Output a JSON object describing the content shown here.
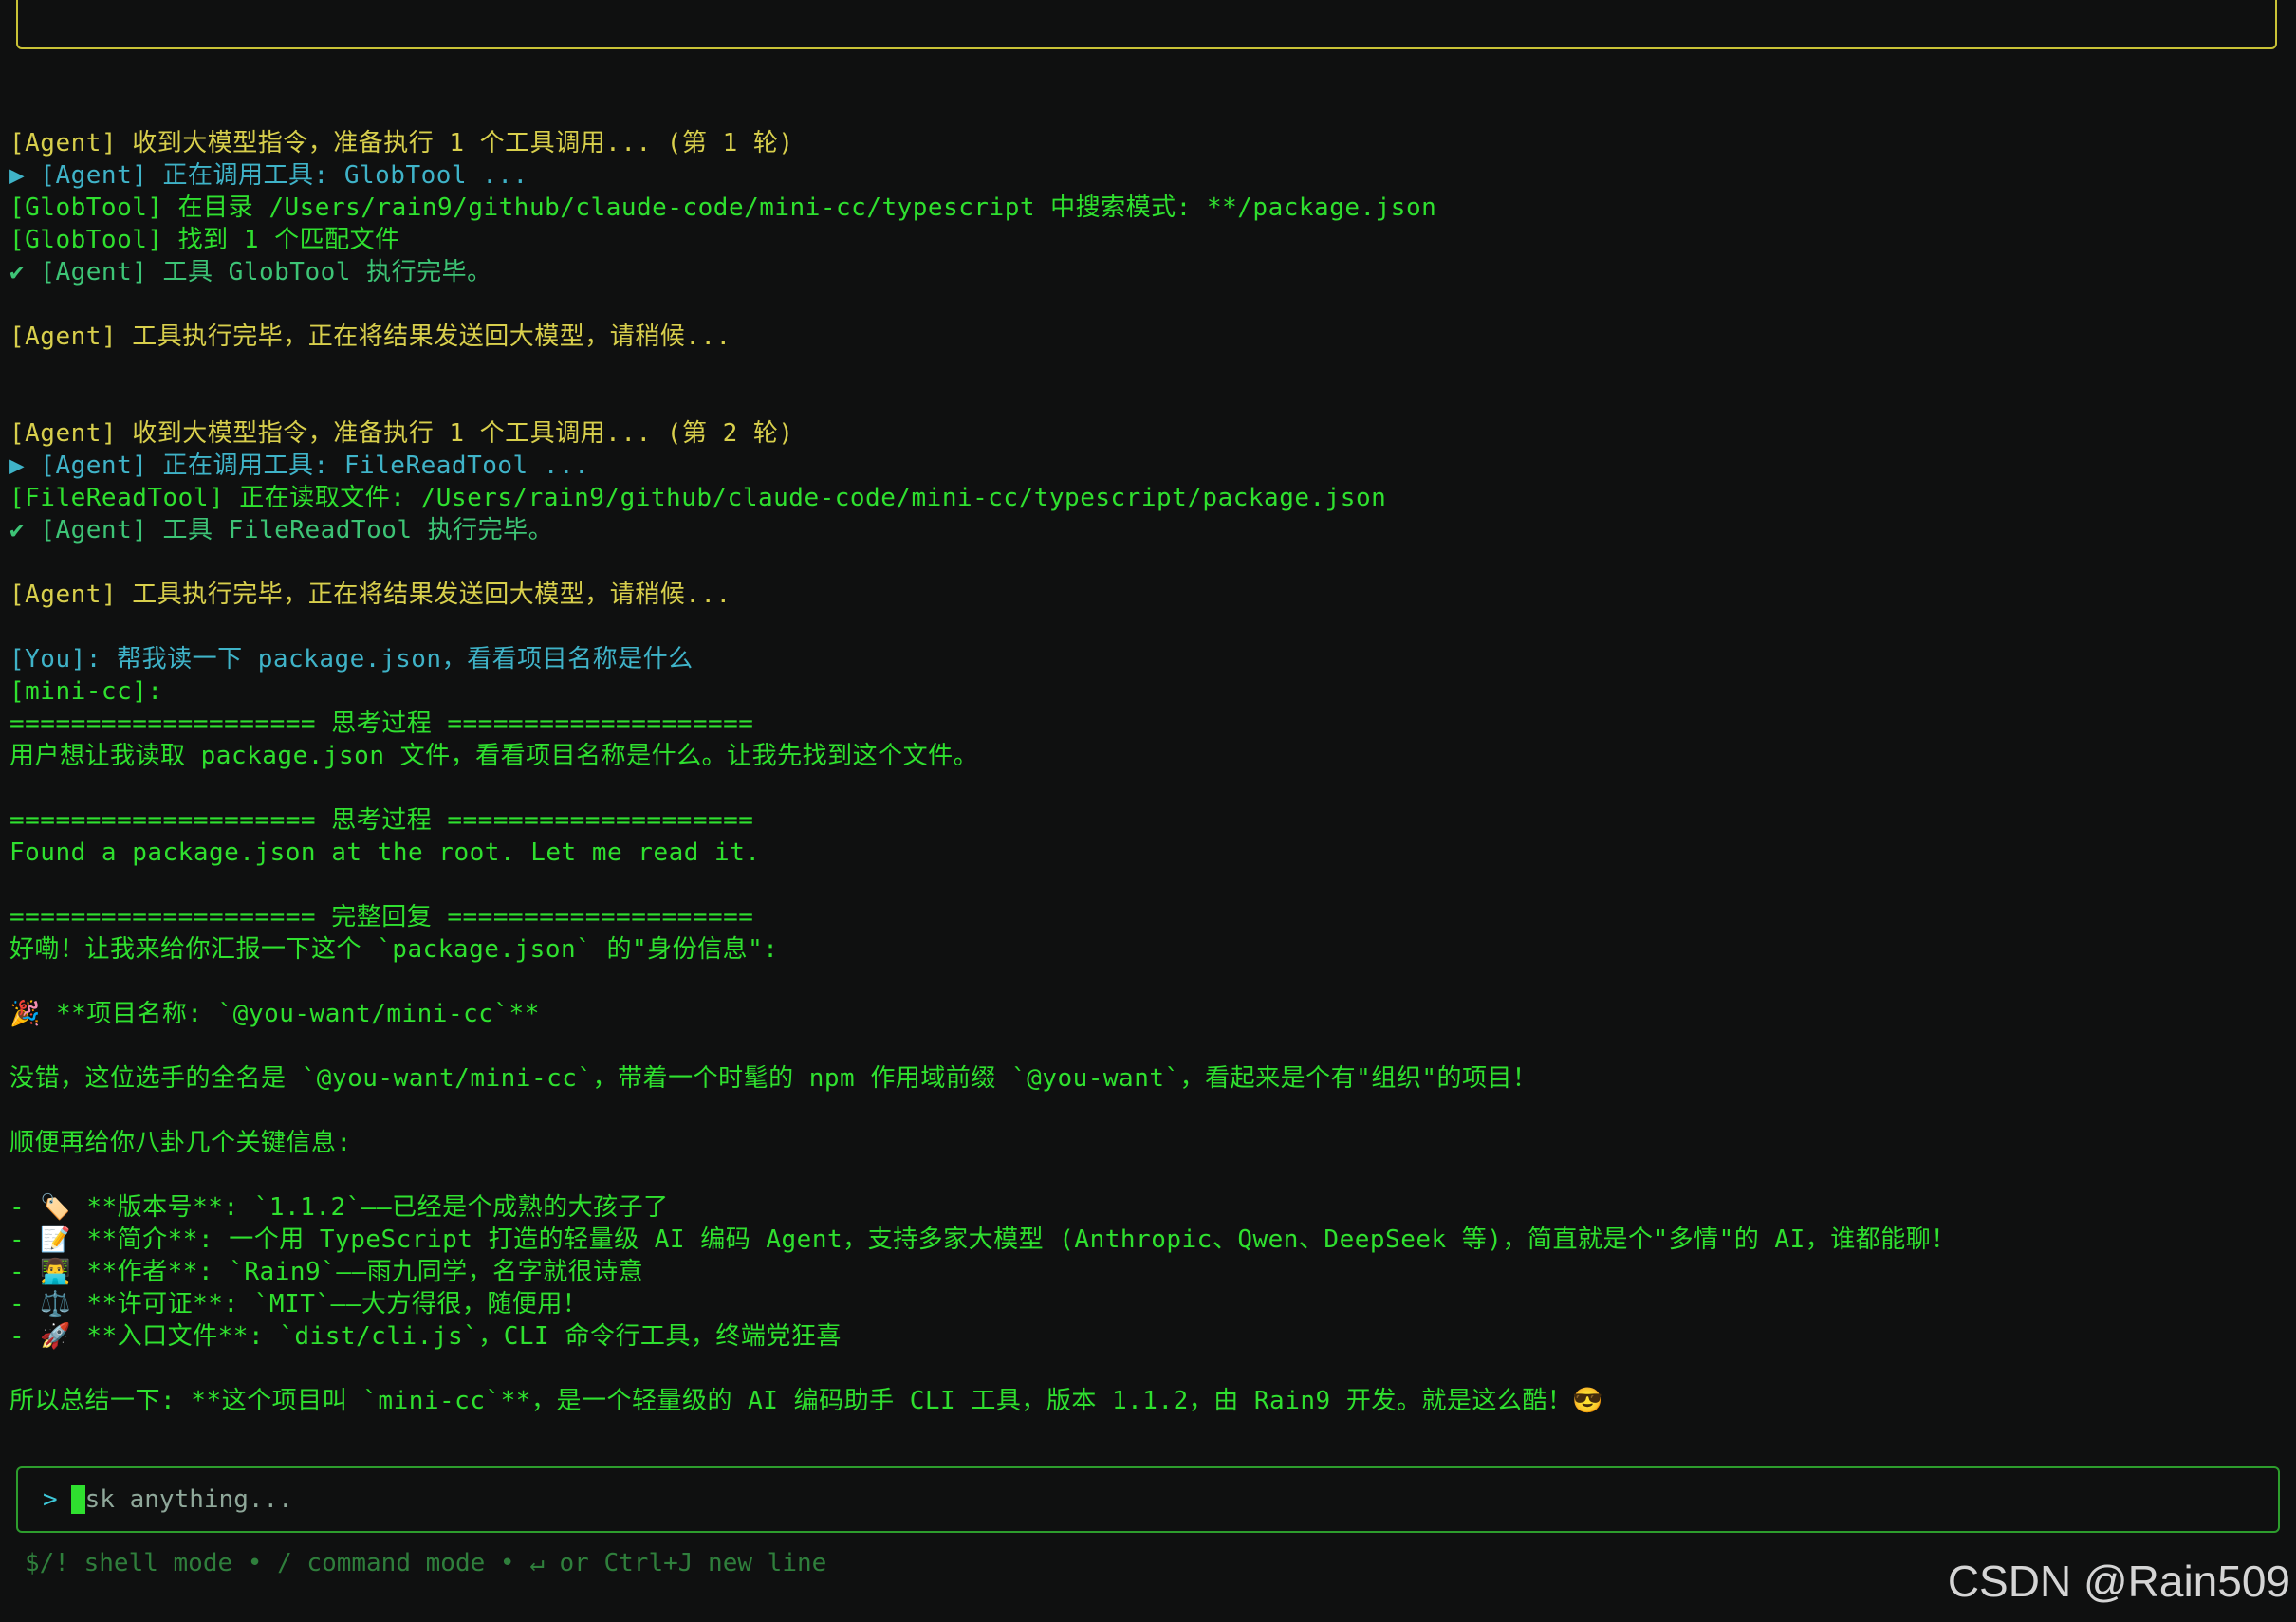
{
  "transcript": [
    {
      "text": "",
      "color": "green"
    },
    {
      "text": "[Agent] 收到大模型指令，准备执行 1 个工具调用... (第 1 轮)",
      "color": "yellow"
    },
    {
      "text": "▶ [Agent] 正在调用工具: GlobTool ...",
      "color": "cyan"
    },
    {
      "text": "[GlobTool] 在目录 /Users/rain9/github/claude-code/mini-cc/typescript 中搜索模式: **/package.json",
      "color": "green"
    },
    {
      "text": "[GlobTool] 找到 1 个匹配文件",
      "color": "green"
    },
    {
      "text": "✔ [Agent] 工具 GlobTool 执行完毕。",
      "color": "mid"
    },
    {
      "text": "",
      "color": "green"
    },
    {
      "text": "[Agent] 工具执行完毕，正在将结果发送回大模型，请稍候...",
      "color": "yellow"
    },
    {
      "text": "",
      "color": "green"
    },
    {
      "text": "",
      "color": "green"
    },
    {
      "text": "[Agent] 收到大模型指令，准备执行 1 个工具调用... (第 2 轮)",
      "color": "yellow"
    },
    {
      "text": "▶ [Agent] 正在调用工具: FileReadTool ...",
      "color": "cyan"
    },
    {
      "text": "[FileReadTool] 正在读取文件: /Users/rain9/github/claude-code/mini-cc/typescript/package.json",
      "color": "green"
    },
    {
      "text": "✔ [Agent] 工具 FileReadTool 执行完毕。",
      "color": "mid"
    },
    {
      "text": "",
      "color": "green"
    },
    {
      "text": "[Agent] 工具执行完毕，正在将结果发送回大模型，请稍候...",
      "color": "yellow"
    },
    {
      "text": "",
      "color": "green"
    },
    {
      "text": "[You]: 帮我读一下 package.json，看看项目名称是什么",
      "color": "cyan"
    },
    {
      "text": "[mini-cc]:",
      "color": "green"
    },
    {
      "text": "==================== 思考过程 ====================",
      "color": "green"
    },
    {
      "text": "用户想让我读取 package.json 文件，看看项目名称是什么。让我先找到这个文件。",
      "color": "green"
    },
    {
      "text": "",
      "color": "green"
    },
    {
      "text": "==================== 思考过程 ====================",
      "color": "green"
    },
    {
      "text": "Found a package.json at the root. Let me read it.",
      "color": "green"
    },
    {
      "text": "",
      "color": "green"
    },
    {
      "text": "==================== 完整回复 ====================",
      "color": "green"
    },
    {
      "text": "好嘞！让我来给你汇报一下这个 `package.json` 的\"身份信息\":",
      "color": "green"
    },
    {
      "text": "",
      "color": "green"
    },
    {
      "text": "🎉 **项目名称: `@you-want/mini-cc`**",
      "color": "green"
    },
    {
      "text": "",
      "color": "green"
    },
    {
      "text": "没错，这位选手的全名是 `@you-want/mini-cc`，带着一个时髦的 npm 作用域前缀 `@you-want`，看起来是个有\"组织\"的项目！",
      "color": "green"
    },
    {
      "text": "",
      "color": "green"
    },
    {
      "text": "顺便再给你八卦几个关键信息:",
      "color": "green"
    },
    {
      "text": "",
      "color": "green"
    },
    {
      "text": "- 🏷️ **版本号**: `1.1.2`——已经是个成熟的大孩子了",
      "color": "green"
    },
    {
      "text": "- 📝 **简介**: 一个用 TypeScript 打造的轻量级 AI 编码 Agent，支持多家大模型 (Anthropic、Qwen、DeepSeek 等)，简直就是个\"多情\"的 AI，谁都能聊！",
      "color": "green"
    },
    {
      "text": "- 👨‍💻 **作者**: `Rain9`——雨九同学，名字就很诗意",
      "color": "green"
    },
    {
      "text": "- ⚖️ **许可证**: `MIT`——大方得很，随便用！",
      "color": "green"
    },
    {
      "text": "- 🚀 **入口文件**: `dist/cli.js`，CLI 命令行工具，终端党狂喜",
      "color": "green"
    },
    {
      "text": "",
      "color": "green"
    },
    {
      "text": "所以总结一下: **这个项目叫 `mini-cc`**，是一个轻量级的 AI 编码助手 CLI 工具，版本 1.1.2，由 Rain9 开发。就是这么酷！😎",
      "color": "green"
    }
  ],
  "input": {
    "prompt": ">",
    "caret_char": "A",
    "rest": "sk anything..."
  },
  "hint": "$/! shell mode • / command mode • ↵ or Ctrl+J new line",
  "watermark": "CSDN @Rain509",
  "colors": {
    "background": "#0f1010",
    "green": "#2fe02f",
    "yellow": "#d8cf4c",
    "cyan": "#3fb3c8",
    "top_border": "#c9c236",
    "input_border": "#2d9d2d"
  }
}
